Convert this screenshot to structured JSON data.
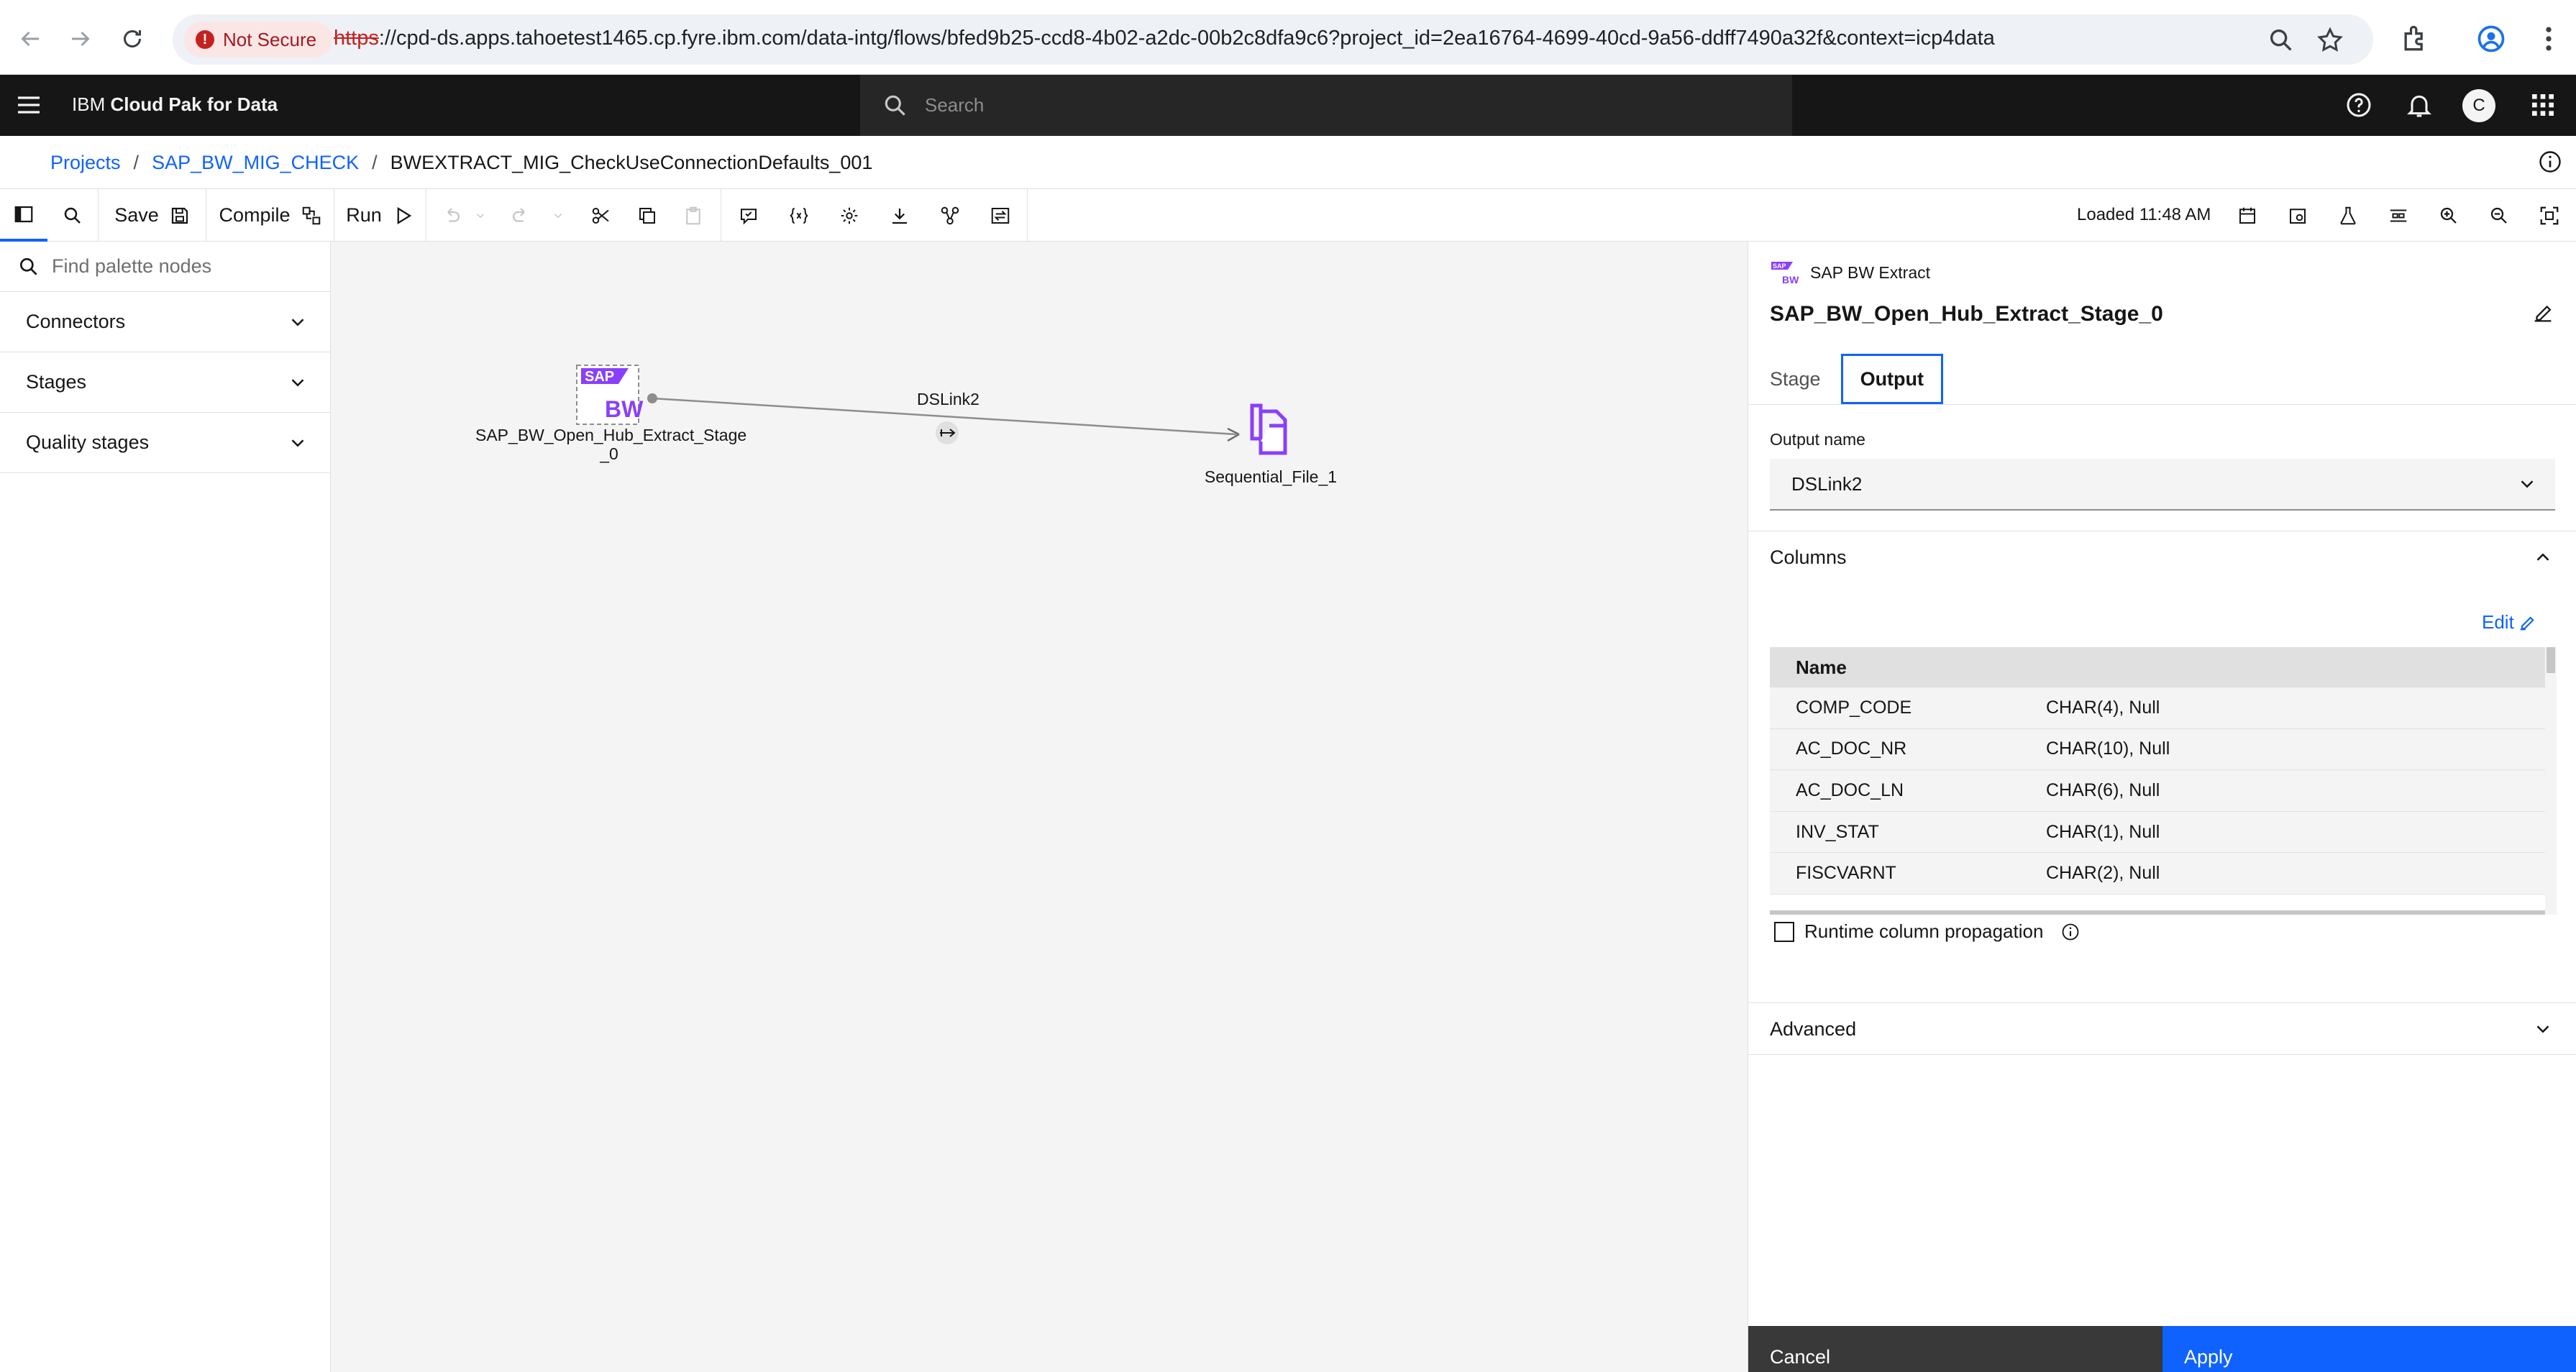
{
  "browser": {
    "security_label": "Not Secure",
    "url_scheme": "https",
    "url_rest": "://cpd-ds.apps.tahoetest1465.cp.fyre.ibm.com/data-intg/flows/bfed9b25-ccd8-4b02-a2dc-00b2c8dfa9c6?project_id=2ea16764-4699-40cd-9a56-ddff7490a32f&context=icp4data"
  },
  "header": {
    "brand_prefix": "IBM",
    "brand_name": "Cloud Pak for Data",
    "search_placeholder": "Search",
    "avatar_initial": "C"
  },
  "breadcrumb": {
    "items": [
      "Projects",
      "SAP_BW_MIG_CHECK"
    ],
    "current": "BWEXTRACT_MIG_CheckUseConnectionDefaults_001"
  },
  "toolbar": {
    "save_label": "Save",
    "compile_label": "Compile",
    "run_label": "Run",
    "status": "Loaded 11:48 AM"
  },
  "palette": {
    "search_placeholder": "Find palette nodes",
    "sections": [
      "Connectors",
      "Stages",
      "Quality stages"
    ]
  },
  "canvas": {
    "source_node": {
      "label_line1": "SAP_BW_Open_Hub_Extract_Stage",
      "label_line2": "_0",
      "icon_text_top": "SAP",
      "icon_text_bottom": "BW"
    },
    "target_node": {
      "label": "Sequential_File_1"
    },
    "link": {
      "label": "DSLink2"
    },
    "colors": {
      "node_purple": "#8a3ffc",
      "link": "#8d8d8d"
    }
  },
  "properties": {
    "stage_type": "SAP BW Extract",
    "stage_name": "SAP_BW_Open_Hub_Extract_Stage_0",
    "tabs": [
      "Stage",
      "Output"
    ],
    "active_tab": "Output",
    "output_name_label": "Output name",
    "output_name_value": "DSLink2",
    "columns_title": "Columns",
    "edit_label": "Edit",
    "columns_header": "Name",
    "columns": [
      {
        "name": "COMP_CODE",
        "type": "CHAR(4), Null"
      },
      {
        "name": "AC_DOC_NR",
        "type": "CHAR(10), Null"
      },
      {
        "name": "AC_DOC_LN",
        "type": "CHAR(6), Null"
      },
      {
        "name": "INV_STAT",
        "type": "CHAR(1), Null"
      },
      {
        "name": "FISCVARNT",
        "type": "CHAR(2), Null"
      }
    ],
    "runtime_propagation_label": "Runtime column propagation",
    "advanced_title": "Advanced",
    "cancel_label": "Cancel",
    "apply_label": "Apply"
  },
  "colors": {
    "accent": "#0f62fe",
    "header_bg": "#161616",
    "danger": "#c5221f"
  }
}
